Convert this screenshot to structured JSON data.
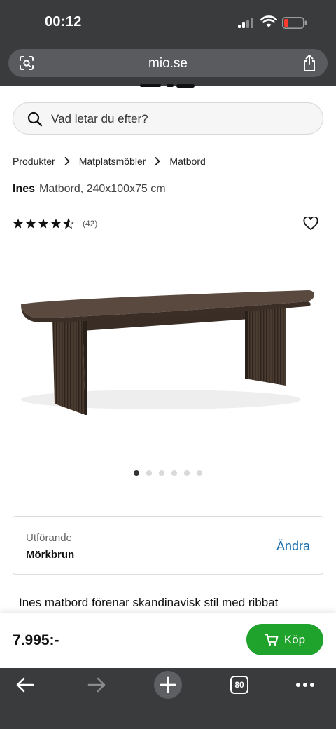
{
  "status_bar": {
    "time": "00:12"
  },
  "browser": {
    "url": "mio.se",
    "open_tabs": "80"
  },
  "search": {
    "placeholder": "Vad letar du efter?"
  },
  "breadcrumb": [
    "Produkter",
    "Matplatsmöbler",
    "Matbord"
  ],
  "product": {
    "brand": "Ines",
    "description": "Matbord, 240x100x75 cm",
    "rating": 4.5,
    "review_count": "(42)",
    "image_count": 6,
    "active_image": 1
  },
  "variant": {
    "label": "Utförande",
    "value": "Mörkbrun",
    "change_label": "Ändra"
  },
  "description_text": "Ines matbord förenar skandinavisk stil med ribbat",
  "buy": {
    "price": "7.995:-",
    "button_label": "Köp"
  },
  "colors": {
    "buy_green": "#1fa32d",
    "link_blue": "#1a6fb0",
    "chrome": "#3a3b3d"
  },
  "icons": [
    "search-icon",
    "chevron-right-icon",
    "star-icon",
    "heart-icon",
    "cart-icon",
    "share-icon",
    "back-arrow-icon",
    "forward-arrow-icon",
    "plus-icon",
    "more-icon"
  ]
}
